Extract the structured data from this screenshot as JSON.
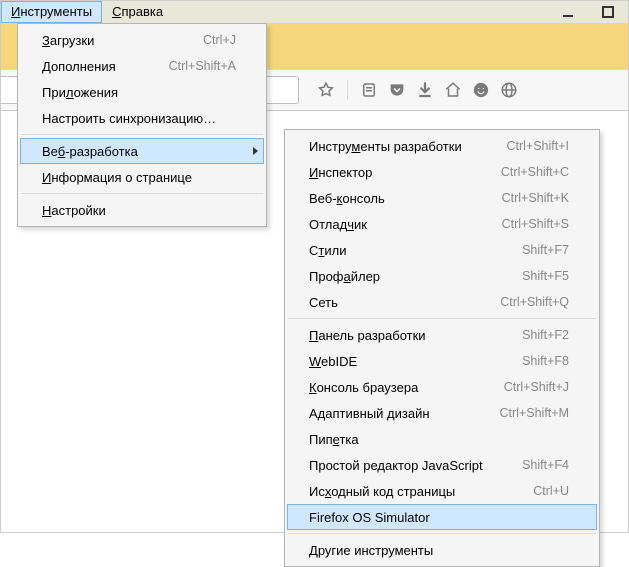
{
  "menubar": {
    "tools": {
      "label": "Инструменты",
      "ukey": "И"
    },
    "help": {
      "label": "Справка",
      "ukey": "С"
    }
  },
  "menu1": {
    "downloads": {
      "label": "Загрузки",
      "ukey": "З",
      "shortcut": "Ctrl+J"
    },
    "addons": {
      "label": "Дополнения",
      "ukey": "Д",
      "shortcut": "Ctrl+Shift+A"
    },
    "apps": {
      "label": "Приложения",
      "ukey": "л"
    },
    "sync": {
      "label": "Настроить синхронизацию…",
      "ukey": ""
    },
    "webdev": {
      "label": "Веб-разработка",
      "ukey": "б"
    },
    "pageinfo": {
      "label": "Информация о странице",
      "ukey": "И"
    },
    "settings": {
      "label": "Настройки",
      "ukey": "Н"
    }
  },
  "menu2": {
    "devtools": {
      "label": "Инструменты разработки",
      "ukey": "м",
      "shortcut": "Ctrl+Shift+I"
    },
    "inspector": {
      "label": "Инспектор",
      "ukey": "И",
      "shortcut": "Ctrl+Shift+C"
    },
    "console": {
      "label": "Веб-консоль",
      "ukey": "к",
      "shortcut": "Ctrl+Shift+K"
    },
    "debugger": {
      "label": "Отладчик",
      "ukey": "ч",
      "shortcut": "Ctrl+Shift+S"
    },
    "styles": {
      "label": "Стили",
      "ukey": "т",
      "shortcut": "Shift+F7"
    },
    "profiler": {
      "label": "Профайлер",
      "ukey": "а",
      "shortcut": "Shift+F5"
    },
    "network": {
      "label": "Сеть",
      "ukey": "",
      "shortcut": "Ctrl+Shift+Q"
    },
    "devbar": {
      "label": "Панель разработки",
      "ukey": "П",
      "shortcut": "Shift+F2"
    },
    "webide": {
      "label": "WebIDE",
      "ukey": "W",
      "shortcut": "Shift+F8"
    },
    "browsercon": {
      "label": "Консоль браузера",
      "ukey": "К",
      "shortcut": "Ctrl+Shift+J"
    },
    "responsive": {
      "label": "Адаптивный дизайн",
      "ukey": "д",
      "shortcut": "Ctrl+Shift+M"
    },
    "eyedropper": {
      "label": "Пипетка",
      "ukey": "е"
    },
    "scratchpad": {
      "label": "Простой редактор JavaScript",
      "ukey": "",
      "shortcut": "Shift+F4"
    },
    "source": {
      "label": "Исходный код страницы",
      "ukey": "х",
      "shortcut": "Ctrl+U"
    },
    "fxos": {
      "label": "Firefox OS Simulator",
      "ukey": ""
    },
    "more": {
      "label": "Другие инструменты",
      "ukey": "Д"
    }
  }
}
